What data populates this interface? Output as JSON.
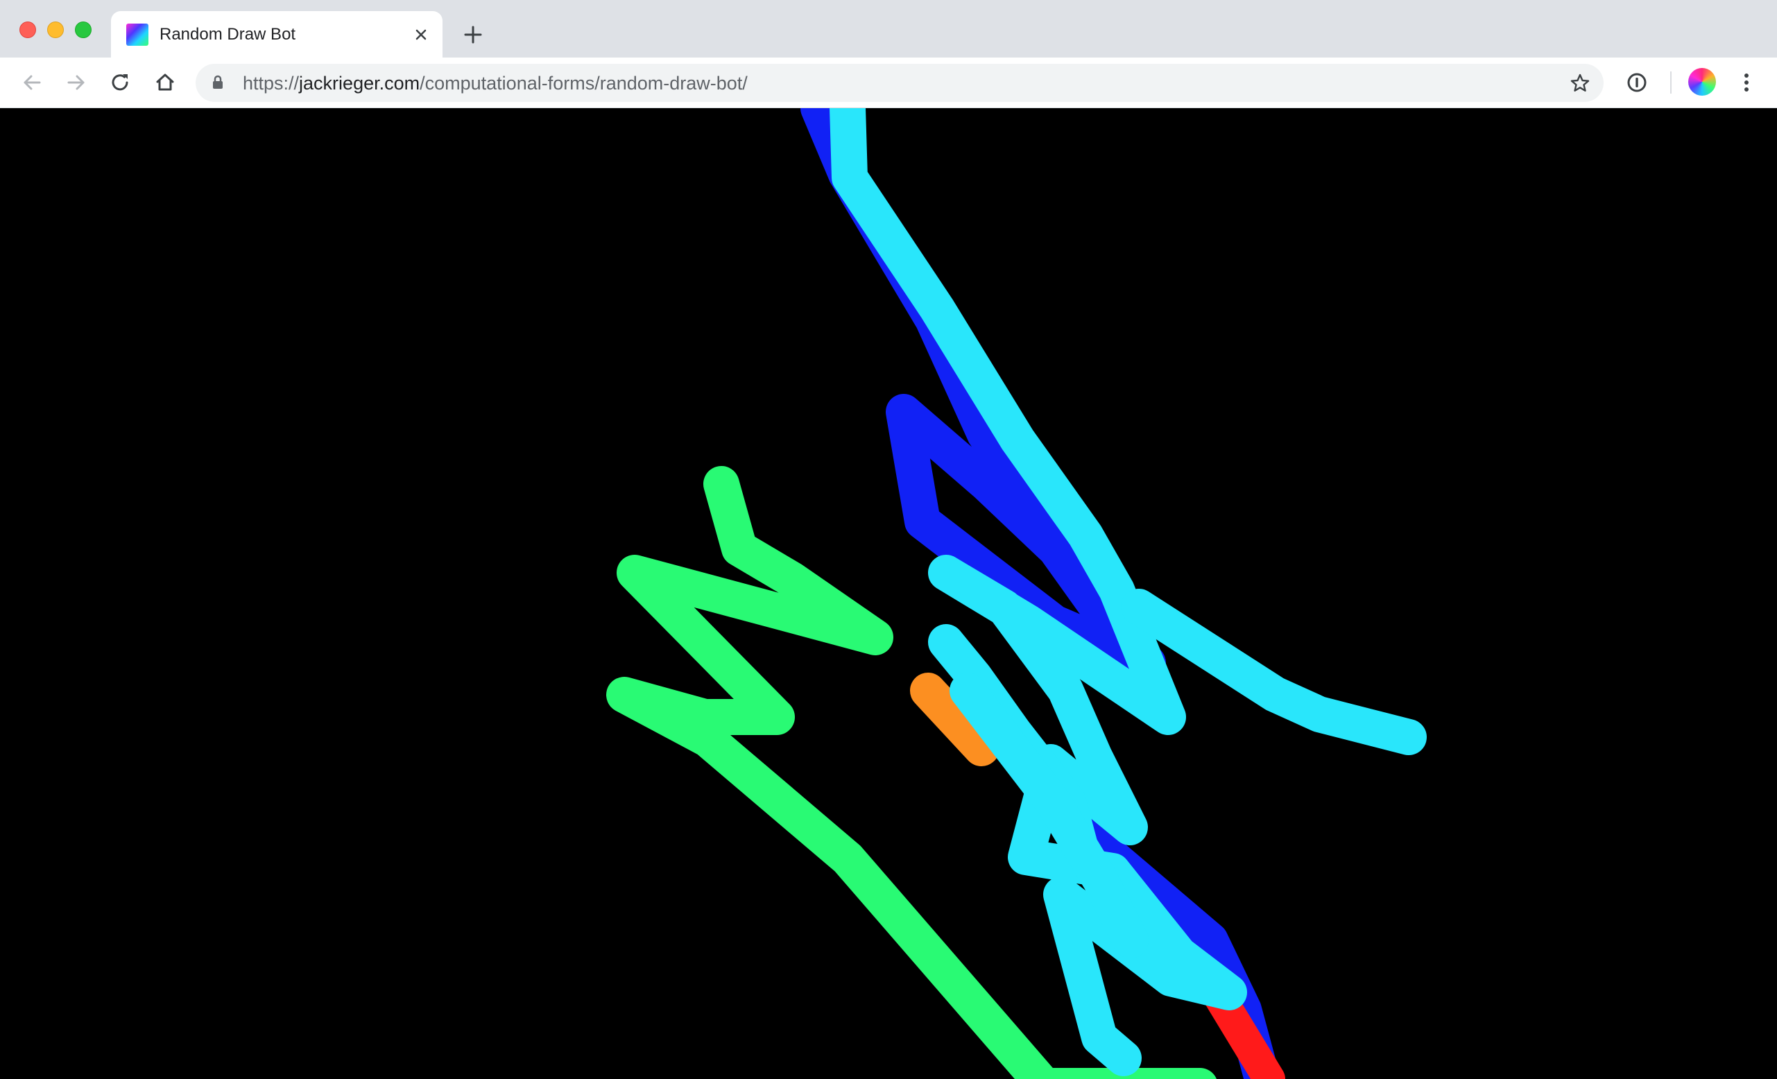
{
  "window": {
    "controls": [
      "close",
      "minimize",
      "maximize"
    ]
  },
  "tab": {
    "title": "Random Draw Bot",
    "favicon_icon": "gradient-square-favicon"
  },
  "toolbar": {
    "back_icon": "arrow-left-icon",
    "forward_icon": "arrow-right-icon",
    "reload_icon": "reload-icon",
    "home_icon": "home-icon",
    "url_scheme": "https://",
    "url_host": "jackrieger.com",
    "url_path": "/computational-forms/random-draw-bot/",
    "bookmark_icon": "star-icon",
    "extension_icon": "info-circle-icon",
    "menu_icon": "kebab-menu-icon"
  },
  "canvas": {
    "background": "#000000",
    "stroke_colors": {
      "cyan": "#29e6fb",
      "blue": "#1121f5",
      "green": "#29fa74",
      "orange": "#fc8f21",
      "red": "#ff1a1a"
    }
  }
}
